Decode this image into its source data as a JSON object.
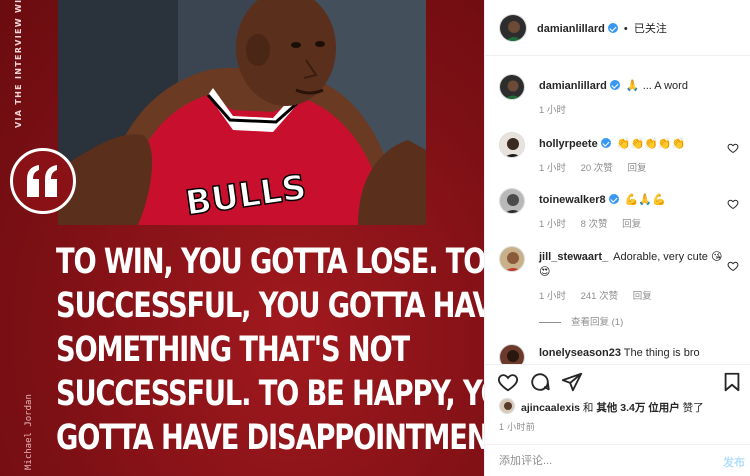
{
  "media": {
    "side_caption": "VIA THE INTERVIEW WITH MA",
    "side_name": "Michael Jordan",
    "jersey_text": "BULLS",
    "quote_lines": [
      "TO WIN, YOU GOTTA LOSE. TO BE",
      "SUCCESSFUL, YOU GOTTA HAVE",
      "SOMETHING THAT'S NOT",
      "SUCCESSFUL. TO BE HAPPY, YOU",
      "GOTTA HAVE DISAPPOINTMENT."
    ]
  },
  "header": {
    "username": "damianlillard",
    "separator": "•",
    "follow_status": "已关注"
  },
  "caption": {
    "username": "damianlillard",
    "text": "... A word",
    "emoji": "🙏",
    "time": "1 小时"
  },
  "comments": [
    {
      "username": "hollyrpeete",
      "verified": true,
      "text": "👏👏👏👏👏",
      "time": "1 小时",
      "likes": "20 次赞",
      "reply": "回复"
    },
    {
      "username": "toinewalker8",
      "verified": true,
      "text": "💪🙏💪",
      "time": "1 小时",
      "likes": "8 次赞",
      "reply": "回复"
    },
    {
      "username": "jill_stewaart_",
      "verified": false,
      "text": "Adorable, very cute 😘😍",
      "time": "1 小时",
      "likes": "241 次赞",
      "reply": "回复"
    },
    {
      "username": "lonelyseason23",
      "verified": false,
      "text": "The thing is bro",
      "time": "",
      "likes": "",
      "reply": ""
    }
  ],
  "view_replies": "查看回复 (1)",
  "likes": {
    "user": "ajincaalexis",
    "connector": "和",
    "others": "其他 3.4万 位用户",
    "suffix": "赞了"
  },
  "post_time": "1 小时前",
  "comment_input": {
    "placeholder": "添加评论...",
    "post_label": "发布"
  },
  "colors": {
    "accent": "#3897f0",
    "brand_red": "#8c1418",
    "muted": "#8e8e8e"
  }
}
